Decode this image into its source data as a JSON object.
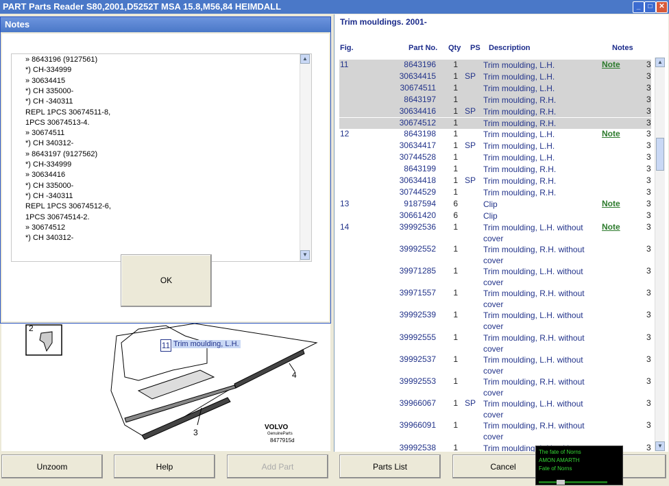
{
  "window": {
    "title": "PART Parts Reader S80,2001,D5252T MSA 15.8,M56,84 HEIMDALL",
    "controls": [
      "minimize",
      "maximize",
      "close"
    ]
  },
  "notes_dialog": {
    "title": "Notes",
    "lines": [
      "» 8643196 (9127561)",
      "*) CH-334999",
      "» 30634415",
      "*) CH 335000-",
      "*) CH -340311",
      "REPL 1PCS 30674511-8,",
      "1PCS 30674513-4.",
      "» 30674511",
      "*) CH 340312-",
      "» 8643197 (9127562)",
      "*) CH-334999",
      "» 30634416",
      "*) CH 335000-",
      "*) CH -340311",
      "REPL 1PCS 30674512-6,",
      "1PCS 30674514-2.",
      "» 30674512",
      "*) CH 340312-"
    ],
    "ok_label": "OK"
  },
  "parts_panel": {
    "title": "Trim mouldings. 2001-",
    "headers": {
      "fig": "Fig.",
      "part_no": "Part No.",
      "qty": "Qty",
      "ps": "PS",
      "desc": "Description",
      "notes": "Notes"
    },
    "rows": [
      {
        "fig": "11",
        "part": "8643196",
        "qty": "1",
        "ps": "",
        "desc": [
          "Trim moulding, L.H."
        ],
        "note": "Note",
        "last": "3",
        "selected": true
      },
      {
        "fig": "",
        "part": "30634415",
        "qty": "1",
        "ps": "SP",
        "desc": [
          "Trim moulding, L.H."
        ],
        "note": "",
        "last": "3",
        "selected": true
      },
      {
        "fig": "",
        "part": "30674511",
        "qty": "1",
        "ps": "",
        "desc": [
          "Trim moulding, L.H."
        ],
        "note": "",
        "last": "3",
        "selected": true
      },
      {
        "fig": "",
        "part": "8643197",
        "qty": "1",
        "ps": "",
        "desc": [
          "Trim moulding, R.H."
        ],
        "note": "",
        "last": "3",
        "selected": true
      },
      {
        "fig": "",
        "part": "30634416",
        "qty": "1",
        "ps": "SP",
        "desc": [
          "Trim moulding, R.H."
        ],
        "note": "",
        "last": "3",
        "selected": true
      },
      {
        "fig": "",
        "part": "30674512",
        "qty": "1",
        "ps": "",
        "desc": [
          "Trim moulding, R.H."
        ],
        "note": "",
        "last": "3",
        "selected": true
      },
      {
        "fig": "12",
        "part": "8643198",
        "qty": "1",
        "ps": "",
        "desc": [
          "Trim moulding, L.H."
        ],
        "note": "Note",
        "last": "3",
        "selected": false
      },
      {
        "fig": "",
        "part": "30634417",
        "qty": "1",
        "ps": "SP",
        "desc": [
          "Trim moulding, L.H."
        ],
        "note": "",
        "last": "3",
        "selected": false
      },
      {
        "fig": "",
        "part": "30744528",
        "qty": "1",
        "ps": "",
        "desc": [
          "Trim moulding, L.H."
        ],
        "note": "",
        "last": "3",
        "selected": false
      },
      {
        "fig": "",
        "part": "8643199",
        "qty": "1",
        "ps": "",
        "desc": [
          "Trim moulding, R.H."
        ],
        "note": "",
        "last": "3",
        "selected": false
      },
      {
        "fig": "",
        "part": "30634418",
        "qty": "1",
        "ps": "SP",
        "desc": [
          "Trim moulding, R.H."
        ],
        "note": "",
        "last": "3",
        "selected": false
      },
      {
        "fig": "",
        "part": "30744529",
        "qty": "1",
        "ps": "",
        "desc": [
          "Trim moulding, R.H."
        ],
        "note": "",
        "last": "3",
        "selected": false
      },
      {
        "fig": "13",
        "part": "9187594",
        "qty": "6",
        "ps": "",
        "desc": [
          "Clip"
        ],
        "note": "Note",
        "last": "3",
        "selected": false
      },
      {
        "fig": "",
        "part": "30661420",
        "qty": "6",
        "ps": "",
        "desc": [
          "Clip"
        ],
        "note": "",
        "last": "3",
        "selected": false
      },
      {
        "fig": "14",
        "part": "39992536",
        "qty": "1",
        "ps": "",
        "desc": [
          "Trim moulding, L.H. without",
          "cover"
        ],
        "note": "Note",
        "last": "3",
        "selected": false
      },
      {
        "fig": "",
        "part": "39992552",
        "qty": "1",
        "ps": "",
        "desc": [
          "Trim moulding, R.H. without",
          "cover"
        ],
        "note": "",
        "last": "3",
        "selected": false
      },
      {
        "fig": "",
        "part": "39971285",
        "qty": "1",
        "ps": "",
        "desc": [
          "Trim moulding, L.H. without",
          "cover"
        ],
        "note": "",
        "last": "3",
        "selected": false
      },
      {
        "fig": "",
        "part": "39971557",
        "qty": "1",
        "ps": "",
        "desc": [
          "Trim moulding, R.H. without",
          "cover"
        ],
        "note": "",
        "last": "3",
        "selected": false
      },
      {
        "fig": "",
        "part": "39992539",
        "qty": "1",
        "ps": "",
        "desc": [
          "Trim moulding, L.H. without",
          "cover"
        ],
        "note": "",
        "last": "3",
        "selected": false
      },
      {
        "fig": "",
        "part": "39992555",
        "qty": "1",
        "ps": "",
        "desc": [
          "Trim moulding, R.H. without",
          "cover"
        ],
        "note": "",
        "last": "3",
        "selected": false
      },
      {
        "fig": "",
        "part": "39992537",
        "qty": "1",
        "ps": "",
        "desc": [
          "Trim moulding, L.H. without",
          "cover"
        ],
        "note": "",
        "last": "3",
        "selected": false
      },
      {
        "fig": "",
        "part": "39992553",
        "qty": "1",
        "ps": "",
        "desc": [
          "Trim moulding, R.H. without",
          "cover"
        ],
        "note": "",
        "last": "3",
        "selected": false
      },
      {
        "fig": "",
        "part": "39966067",
        "qty": "1",
        "ps": "SP",
        "desc": [
          "Trim moulding, L.H. without",
          "cover"
        ],
        "note": "",
        "last": "3",
        "selected": false
      },
      {
        "fig": "",
        "part": "39966091",
        "qty": "1",
        "ps": "",
        "desc": [
          "Trim moulding, R.H. without",
          "cover"
        ],
        "note": "",
        "last": "3",
        "selected": false
      },
      {
        "fig": "",
        "part": "39992538",
        "qty": "1",
        "ps": "",
        "desc": [
          "Trim moulding, L.H. without"
        ],
        "note": "",
        "last": "3",
        "selected": false
      }
    ]
  },
  "diagram": {
    "callout_number": "11",
    "callout_label": "Trim moulding, L.H.",
    "labels": [
      "2",
      "3",
      "4"
    ],
    "brand": "VOLVO",
    "brand_sub": "GenuineParts",
    "drawing_no": "8477915d"
  },
  "buttons": {
    "unzoom": "Unzoom",
    "help": "Help",
    "add_part": "Add Part",
    "parts_list": "Parts List",
    "cancel": "Cancel"
  },
  "media_overlay": {
    "lines": [
      "The fate of Norns",
      "AMON AMARTH",
      "Fate of Norns"
    ]
  },
  "colors": {
    "title_bar": "#4a78c8",
    "selection": "#d4d4d4",
    "text_blue": "#22338a",
    "note_green": "#2b7a2b"
  }
}
